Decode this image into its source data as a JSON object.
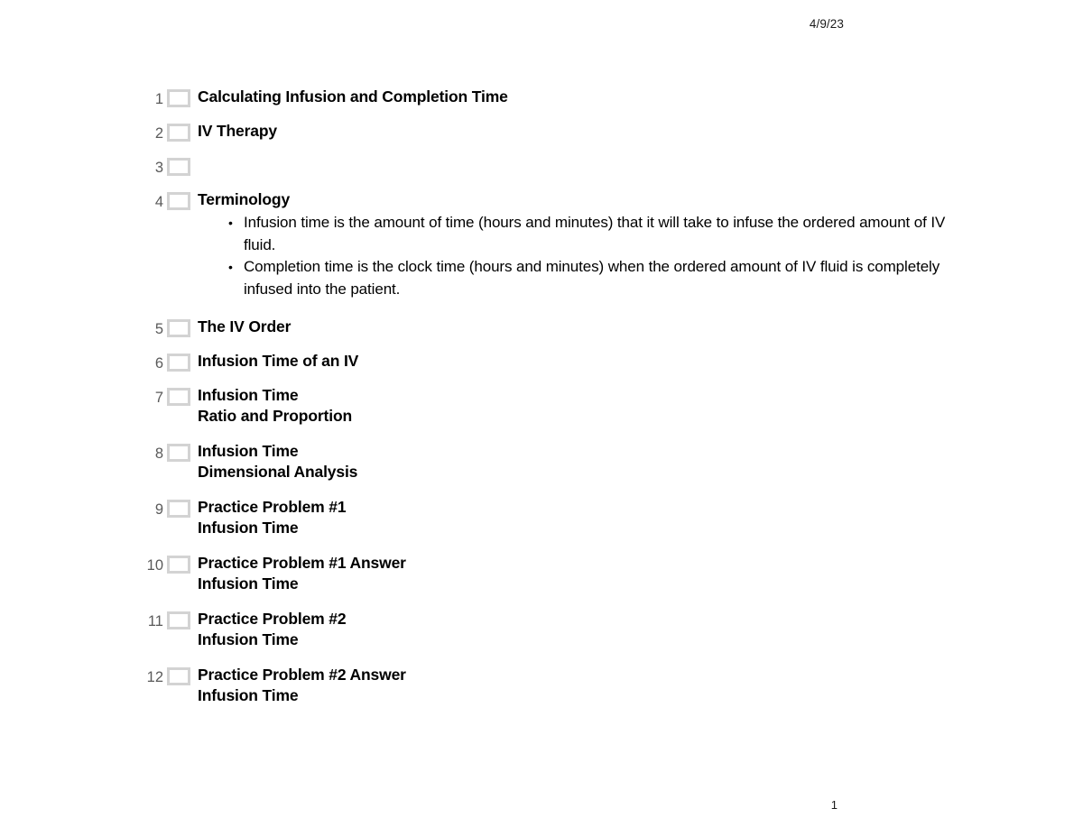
{
  "document": {
    "header_date": "4/9/23",
    "page_number": "1"
  },
  "outline": {
    "items": [
      {
        "number": "1",
        "title": "Calculating Infusion and Completion Time",
        "bullets": []
      },
      {
        "number": "2",
        "title": "IV Therapy",
        "bullets": []
      },
      {
        "number": "3",
        "title": "",
        "bullets": []
      },
      {
        "number": "4",
        "title": "Terminology",
        "bullets": [
          "Infusion time is the amount of time (hours and minutes) that it will take to infuse the ordered amount of IV fluid.",
          "Completion time is the clock time (hours and minutes) when the ordered amount of IV fluid is completely infused into the patient."
        ]
      },
      {
        "number": "5",
        "title": "The IV Order",
        "bullets": []
      },
      {
        "number": "6",
        "title": "Infusion Time of an IV",
        "bullets": []
      },
      {
        "number": "7",
        "title": "Infusion Time\nRatio and Proportion",
        "bullets": []
      },
      {
        "number": "8",
        "title": "Infusion Time\nDimensional Analysis",
        "bullets": []
      },
      {
        "number": "9",
        "title": "Practice Problem #1\nInfusion Time",
        "bullets": []
      },
      {
        "number": "10",
        "title": "Practice Problem #1 Answer\nInfusion Time",
        "bullets": []
      },
      {
        "number": "11",
        "title": "Practice Problem #2\nInfusion Time",
        "bullets": []
      },
      {
        "number": "12",
        "title": "Practice Problem #2 Answer\nInfusion Time",
        "bullets": []
      }
    ]
  }
}
